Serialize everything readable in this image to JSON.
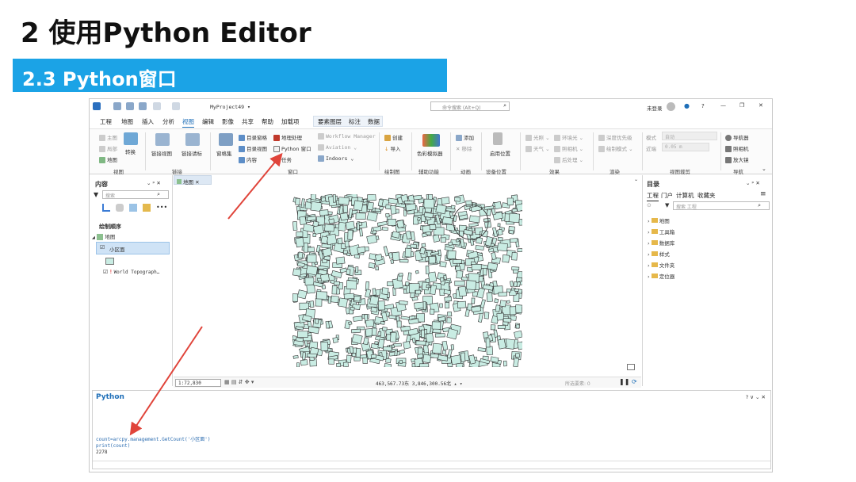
{
  "slide": {
    "title": "2 使用Python Editor",
    "section": "2.3 Python窗口"
  },
  "titlebar": {
    "project": "MyProject49 ▾",
    "search_placeholder": "命令搜索 (Alt+Q)",
    "user": "未登录",
    "help": "?",
    "minimize": "—",
    "maximize": "❐",
    "close": "✕"
  },
  "tabs": [
    "工程",
    "地图",
    "插入",
    "分析",
    "视图",
    "编辑",
    "影像",
    "共享",
    "帮助",
    "加载项",
    "要素图层",
    "标注",
    "数据"
  ],
  "ribbon": {
    "view_group": {
      "b1": "主图",
      "b2": "局部",
      "b3": "转换",
      "b4": "地图",
      "label": "视图"
    },
    "link_group": {
      "b1": "链接视图",
      "b2": "链接请标",
      "label": "链接"
    },
    "window_group": {
      "catalog_pane": "目录窗格",
      "catalog_view": "目录视图",
      "contents": "内容",
      "geoprocessing": "地理处理",
      "python": "Python 窗口",
      "tasks": "任务",
      "workflow": "Workflow Manager",
      "aviation": "Aviation",
      "indoors": "Indoors",
      "reset": "窗格集",
      "label": "窗口"
    },
    "draw_group": {
      "create": "创建",
      "import": "导入",
      "label": "绘制图"
    },
    "color_group": {
      "b1": "色彩模拟器",
      "label": "辅助功能"
    },
    "anim_group": {
      "add": "添加",
      "remove": "移除",
      "label": "动画"
    },
    "device_group": {
      "b1": "启用位置",
      "label": "设备位置"
    },
    "effects_group": {
      "light": "光照",
      "weather": "天气",
      "ambient": "环境光",
      "camera": "照相机",
      "hdr": "后处理",
      "label": "效果"
    },
    "render_group": {
      "b1": "深度优先级",
      "b2": "绘制模式",
      "label": "渲染"
    },
    "clip_group": {
      "mode": "模式",
      "mode_val": "自动",
      "near": "近端",
      "near_val": "0.05 m",
      "label": "视图裁剪"
    },
    "nav_group": {
      "b1": "导航器",
      "b2": "照相机",
      "b3": "放大镜",
      "label": "导航"
    }
  },
  "contents": {
    "title": "内容",
    "search_placeholder": "搜索",
    "draw_order": "绘制顺序",
    "map_layer": "地图",
    "layer": "小区面",
    "basemap": "World Topograph…"
  },
  "map": {
    "tab": "地图",
    "scale": "1:72,830",
    "coords": "463,567.73东 3,846,300.56北 ▴ ▾",
    "selected": "所选要素: 0"
  },
  "catalog": {
    "title": "目录",
    "tabs": [
      "工程",
      "门户",
      "计算机",
      "收藏夹"
    ],
    "search_placeholder": "搜索 工程",
    "items": [
      "地图",
      "工具箱",
      "数据库",
      "样式",
      "文件夹",
      "定位器"
    ]
  },
  "python": {
    "title": "Python",
    "controls": "? ∨ ⌄ ✕",
    "code_line1": "count=arcpy.management.GetCount('小区面')",
    "code_line2": "print(count)",
    "output": "2278"
  },
  "colors": {
    "accent": "#1ba3e6",
    "ribbon_blue": "#1f6fb8",
    "map_fill": "#c9ece3",
    "arrow": "#e0443a"
  }
}
